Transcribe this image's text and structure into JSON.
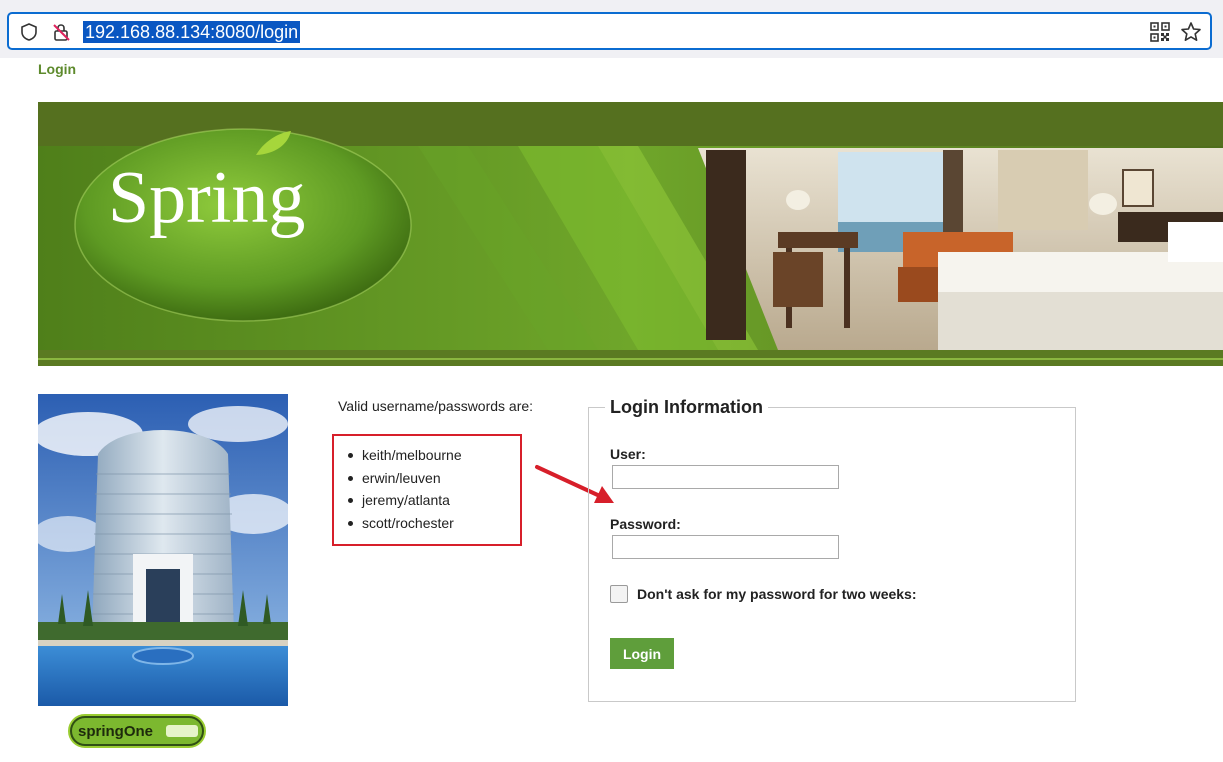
{
  "browser": {
    "url": "192.168.88.134:8080/login"
  },
  "page": {
    "heading": "Login"
  },
  "banner": {
    "logo_text": "Spring"
  },
  "badge": {
    "text": "springOne"
  },
  "credentials": {
    "heading": "Valid username/passwords are:",
    "items": [
      "keith/melbourne",
      "erwin/leuven",
      "jeremy/atlanta",
      "scott/rochester"
    ]
  },
  "login": {
    "legend": "Login Information",
    "user_label": "User:",
    "user_value": "",
    "password_label": "Password:",
    "password_value": "",
    "remember_label": "Don't ask for my password for two weeks:",
    "remember_checked": false,
    "button_label": "Login"
  },
  "colors": {
    "heading_green": "#5d8a2c",
    "button_green": "#5f9e3b",
    "highlight_red": "#d71f2a",
    "url_focus": "#0b6cd1"
  }
}
